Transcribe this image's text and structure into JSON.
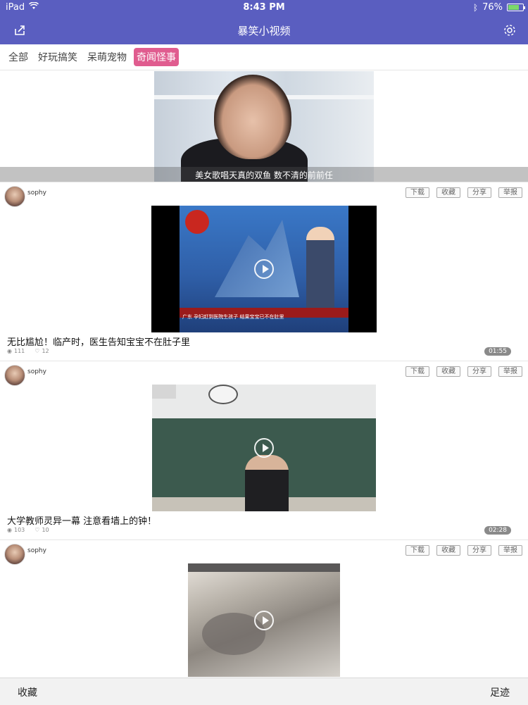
{
  "status_bar": {
    "device": "iPad",
    "time": "8:43 PM",
    "battery": "76%",
    "battery_level": 0.76
  },
  "nav": {
    "title": "暴笑小视频",
    "left_icon": "share-icon",
    "right_icon": "gear-icon"
  },
  "tabs": [
    {
      "label": "全部",
      "active": false
    },
    {
      "label": "好玩搞笑",
      "active": false
    },
    {
      "label": "呆萌宠物",
      "active": false
    },
    {
      "label": "奇闻怪事",
      "active": true
    }
  ],
  "colors": {
    "nav_bg": "#5a5ec0",
    "active_tab": "#e05c8f"
  },
  "hero": {
    "caption": "美女歌唱天真的双鱼 数不清的前前任"
  },
  "actions": {
    "download": "下载",
    "favorite": "收藏",
    "share": "分享",
    "report": "举报"
  },
  "posts": [
    {
      "author": "sophy",
      "title": "无比尴尬！临产时，医生告知宝宝不在肚子里",
      "views": "111",
      "likes": "12",
      "duration": "01:55",
      "ticker": "广东  孕妇赶到医院生孩子  结果宝宝已不在肚里"
    },
    {
      "author": "sophy",
      "title": "大学教师灵异一幕 注意看墙上的钟！",
      "views": "103",
      "likes": "10",
      "duration": "02:28"
    },
    {
      "author": "sophy"
    }
  ],
  "bottom_bar": {
    "left": "收藏",
    "right": "足迹"
  }
}
